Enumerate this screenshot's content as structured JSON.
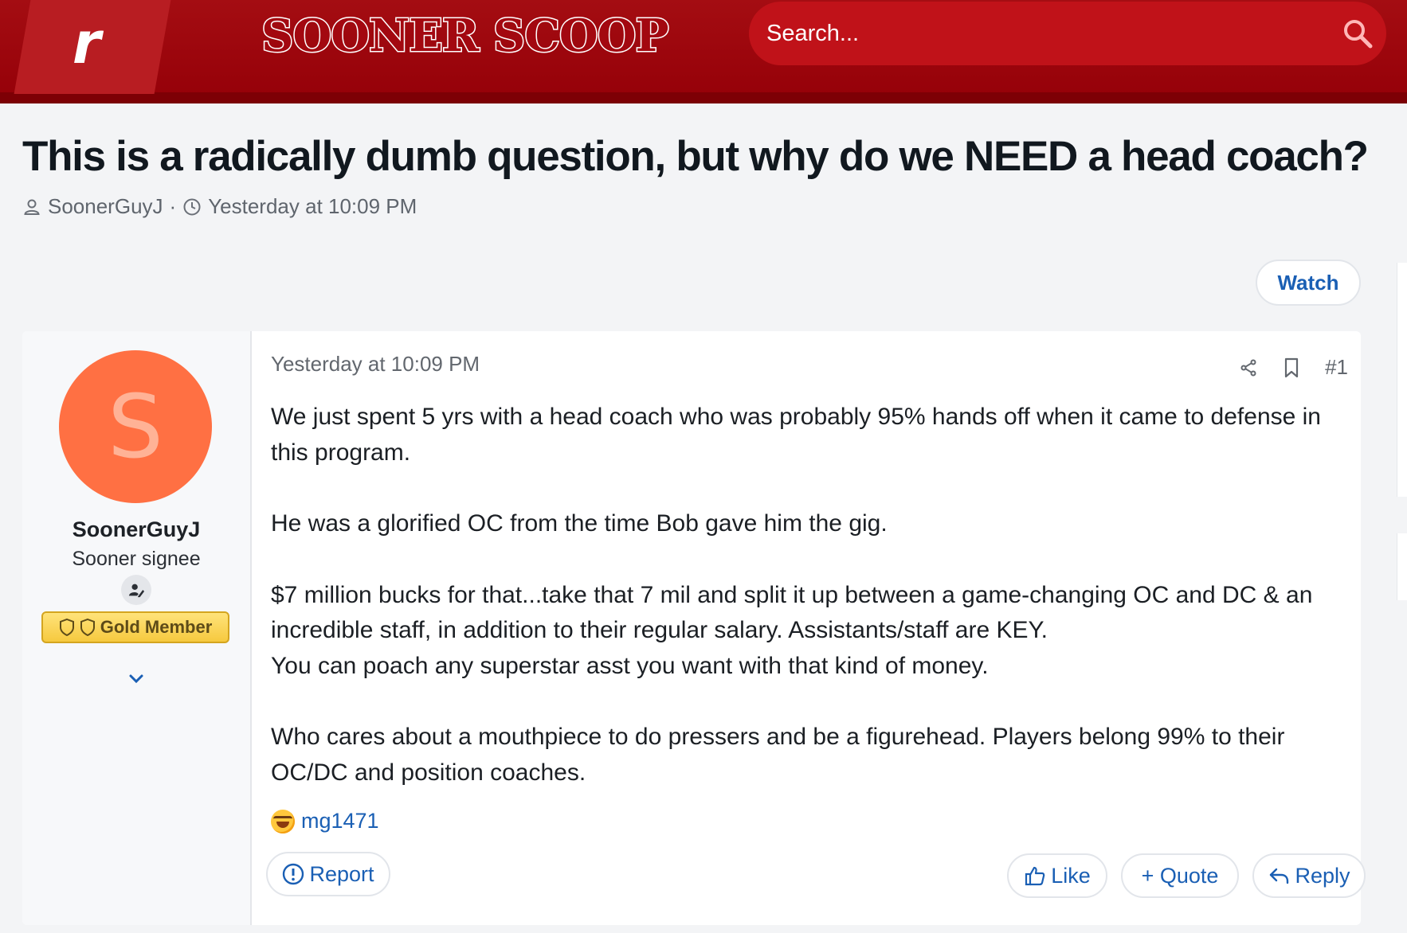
{
  "header": {
    "logo_letter": "r",
    "site_name": "SOONER SCOOP",
    "search_placeholder": "Search..."
  },
  "thread": {
    "title": "This is a radically dumb question, but why do we NEED a head coach?",
    "author": "SoonerGuyJ",
    "separator": "·",
    "time": "Yesterday at 10:09 PM",
    "watch_label": "Watch"
  },
  "post": {
    "avatar_letter": "S",
    "username": "SoonerGuyJ",
    "user_title": "Sooner signee",
    "badge_label": "Gold Member",
    "date": "Yesterday at 10:09 PM",
    "post_number": "#1",
    "paragraphs": [
      "We just spent 5 yrs with a head coach who was probably 95% hands off when it came to defense in this program.",
      "He was a glorified OC from the time Bob gave him the gig.",
      "$7 million bucks for that...take that 7 mil and split it up between a game-changing OC and DC & an incredible staff, in addition to their regular salary. Assistants/staff are KEY.",
      "You can poach any superstar asst you want with that kind of money.",
      "Who cares about a mouthpiece to do pressers and be a figurehead. Players belong 99% to their OC/DC and position coaches."
    ],
    "reaction_user": "mg1471",
    "report_label": "Report",
    "like_label": "Like",
    "quote_label": "+ Quote",
    "reply_label": "Reply"
  },
  "colors": {
    "header_red": "#a40d12",
    "search_red": "#c01219",
    "link_blue": "#1a5fb4",
    "avatar_orange": "#ff7043",
    "gold": "#f6c93f"
  }
}
